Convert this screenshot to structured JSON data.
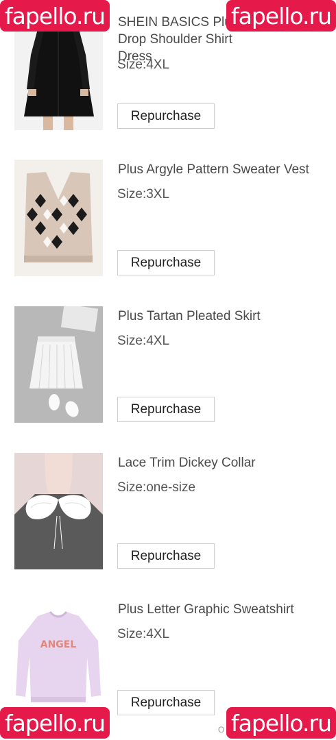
{
  "items": [
    {
      "title": "SHEIN BASICS Plus Drop Shoulder Shirt Dress",
      "size": "Size:4XL",
      "button": "Repurchase",
      "image": "black-shirt-dress"
    },
    {
      "title": "Plus Argyle Pattern Sweater Vest",
      "size": "Size:3XL",
      "button": "Repurchase",
      "image": "argyle-sweater-vest"
    },
    {
      "title": "Plus Tartan Pleated Skirt",
      "size": "Size:4XL",
      "button": "Repurchase",
      "image": "white-pleated-skirt"
    },
    {
      "title": "Lace Trim Dickey Collar",
      "size": "Size:one-size",
      "button": "Repurchase",
      "image": "lace-collar"
    },
    {
      "title": "Plus Letter Graphic Sweatshirt",
      "size": "Size:4XL",
      "button": "Repurchase",
      "image": "lilac-sweatshirt"
    }
  ],
  "watermark": {
    "text": "fapello.ru",
    "color": "#e6194b"
  },
  "footer_fragment": "O"
}
